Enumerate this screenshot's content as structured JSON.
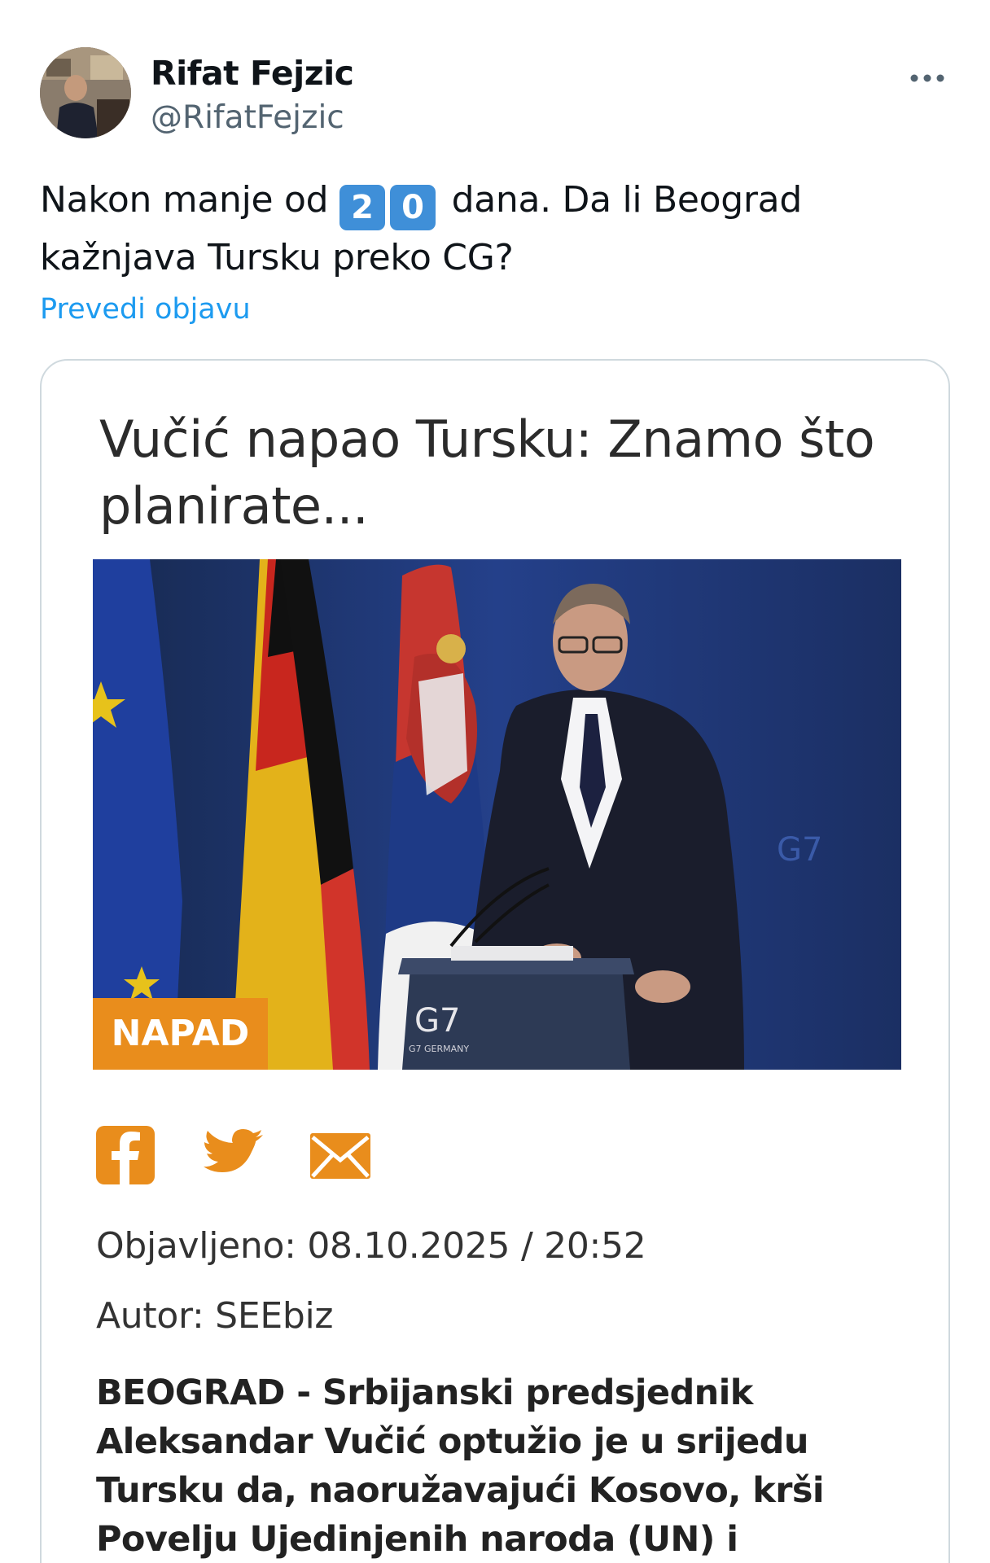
{
  "post": {
    "author_name": "Rifat Fejzic",
    "author_handle": "@RifatFejzic",
    "more_icon": "more-horizontal-icon",
    "text_before": "Nakon manje od",
    "keycap_1": "2",
    "keycap_2": "0",
    "text_after": "dana. Da li Beograd kažnjava Tursku preko CG?",
    "translate_label": "Prevedi objavu"
  },
  "card": {
    "headline": "Vučić napao Tursku: Znamo što planirate...",
    "category_tag": "NAPAD",
    "podium_logo": "G7",
    "podium_sub": "G7 GERMANY",
    "share_icons": [
      "facebook-icon",
      "twitter-icon",
      "mail-icon"
    ],
    "published": "Objavljeno: 08.10.2025 / 20:52",
    "author": "Autor: SEEbiz",
    "lead": "BEOGRAD - Srbijanski predsjednik Aleksandar Vučić optužio je u srijedu Tursku da, naoružavajući Kosovo, krši Povelju Ujedinjenih naroda (UN) i rezolucije Vijeća sigurnosti UN."
  },
  "colors": {
    "link": "#1d9bf0",
    "accent_orange": "#e98d1c",
    "keycap_blue": "#3f8fd8",
    "photo_bg": "#22386e"
  }
}
